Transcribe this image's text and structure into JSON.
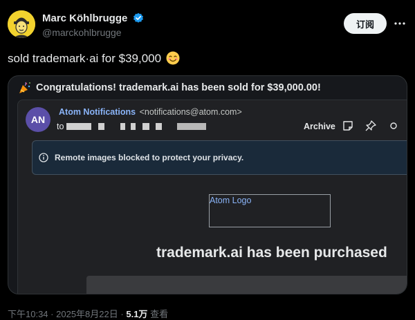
{
  "author": {
    "name": "Marc Köhlbrugge",
    "handle": "@marckohlbrugge",
    "verified_icon": "verified-badge-icon"
  },
  "subscribe_label": "订阅",
  "tweet": {
    "text": "sold trademark·ai for $39,000",
    "emoji": "smiling-face-emoji"
  },
  "email": {
    "subject": "Congratulations! trademark.ai has been sold for $39,000.00!",
    "sender_initials": "AN",
    "sender_name": "Atom Notifications",
    "sender_email": "<notifications@atom.com>",
    "to_label": "to",
    "archive_label": "Archive",
    "privacy_notice": "Remote images blocked to protect your privacy.",
    "logo_alt": "Atom Logo",
    "headline": "trademark.ai has been purchased"
  },
  "footer": {
    "time": "下午10:34",
    "date": "2025年8月22日",
    "separator": "·",
    "views_count": "5.1万",
    "views_label": "查看"
  },
  "colors": {
    "accent_blue": "#1d9bf0",
    "link_blue": "#8ab4f8",
    "avatar_yellow": "#f2d22e",
    "sender_avatar": "#5b4fa8"
  }
}
